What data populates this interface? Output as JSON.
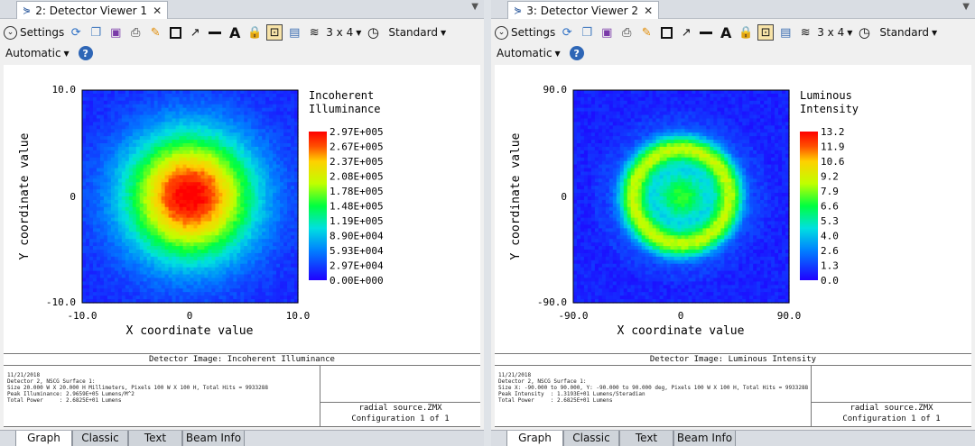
{
  "toolbar": {
    "settings": "Settings",
    "layout": "3 x 4",
    "style": "Standard",
    "scale": "Automatic"
  },
  "bottom_tabs": [
    "Graph",
    "Classic",
    "Text",
    "Beam Info"
  ],
  "panels": [
    {
      "tab_title": "2: Detector Viewer 1",
      "footer_title": "Detector Image: Incoherent Illuminance",
      "footer_info": "11/21/2018\nDetector 2, NSCG Surface 1:\nSize 20.000 W X 20.000 H Millimeters, Pixels 100 W X 100 H, Total Hits = 9933288\nPeak Illuminance: 2.9659E+05 Lumens/M^2\nTotal Power     : 2.6825E+01 Lumens",
      "footer_file": "radial source.ZMX",
      "footer_config": "Configuration 1 of 1",
      "chart_data": {
        "type": "heatmap",
        "legend_title": [
          "Incoherent",
          "Illuminance"
        ],
        "xlabel": "X coordinate value",
        "ylabel": "Y coordinate value",
        "x_ticks": [
          "-10.0",
          "0",
          "10.0"
        ],
        "y_ticks": [
          "10.0",
          "0",
          "-10.0"
        ],
        "xlim": [
          -10.0,
          10.0
        ],
        "ylim": [
          -10.0,
          10.0
        ],
        "colorbar_labels": [
          "2.97E+005",
          "2.67E+005",
          "2.37E+005",
          "2.08E+005",
          "1.78E+005",
          "1.48E+005",
          "1.19E+005",
          "8.90E+004",
          "5.93E+004",
          "2.97E+004",
          "0.00E+000"
        ],
        "pattern": "gaussian"
      }
    },
    {
      "tab_title": "3: Detector Viewer 2",
      "footer_title": "Detector Image: Luminous Intensity",
      "footer_info": "11/21/2018\nDetector 2, NSCG Surface 1:\nSize X: -90.000 to 90.000, Y: -90.000 to 90.000 deg, Pixels 100 W X 100 H, Total Hits = 9933288\nPeak Intensity  : 1.3193E+01 Lumens/Steradian\nTotal Power     : 2.6825E+01 Lumens",
      "footer_file": "radial source.ZMX",
      "footer_config": "Configuration 1 of 1",
      "chart_data": {
        "type": "heatmap",
        "legend_title": [
          "Luminous",
          "Intensity"
        ],
        "xlabel": "X coordinate value",
        "ylabel": "Y coordinate value",
        "x_ticks": [
          "-90.0",
          "0",
          "90.0"
        ],
        "y_ticks": [
          "90.0",
          "0",
          "-90.0"
        ],
        "xlim": [
          -90.0,
          90.0
        ],
        "ylim": [
          -90.0,
          90.0
        ],
        "colorbar_labels": [
          "13.2",
          "11.9",
          "10.6",
          "9.2",
          "7.9",
          "6.6",
          "5.3",
          "4.0",
          "2.6",
          "1.3",
          "0.0"
        ],
        "pattern": "ring"
      }
    }
  ]
}
